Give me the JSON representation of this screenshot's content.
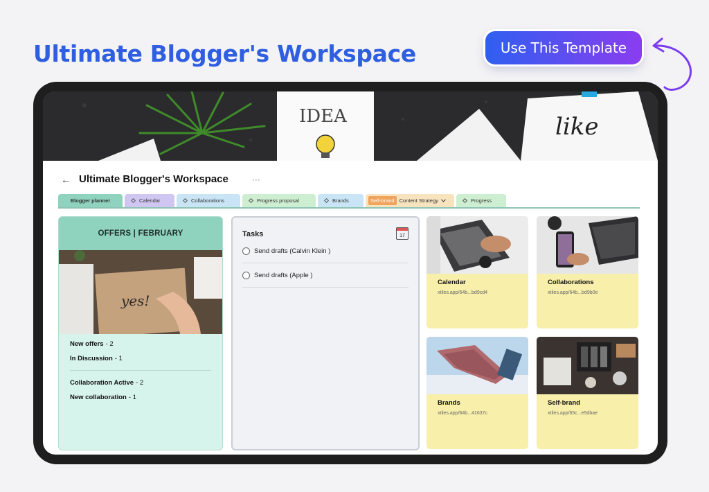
{
  "promo": {
    "title": "Ultimate Blogger's Workspace",
    "cta_label": "Use This Template"
  },
  "banner": {
    "card_word_1": "IDEA",
    "card_word_2": "like"
  },
  "doc": {
    "title": "Ultimate Blogger's Workspace",
    "more": "···",
    "back": "←"
  },
  "tabs": [
    {
      "label": "Blogger planner"
    },
    {
      "label": "Calendar"
    },
    {
      "label": "Collaborations"
    },
    {
      "label": "Progress proposal"
    },
    {
      "label": "Brands"
    },
    {
      "badge": "Self-brand",
      "label": "Content Strategy"
    },
    {
      "label": "Progress"
    }
  ],
  "offers": {
    "title": "OFFERS | FEBRUARY",
    "image_text": "yes!",
    "rows": [
      {
        "label": "New offers",
        "value": "- 2"
      },
      {
        "label": "In Discussion",
        "value": "- 1"
      },
      {
        "label": "Collaboration Active",
        "value": " - 2"
      },
      {
        "label": "New collaboration",
        "value": "- 1"
      }
    ]
  },
  "tasks": {
    "title": "Tasks",
    "calendar_day": "17",
    "items": [
      {
        "label": "Send drafts (Calvin Klein )"
      },
      {
        "label": "Send drafts (Apple )"
      }
    ]
  },
  "tiles": [
    {
      "name": "Calendar",
      "link": "xtiles.app/64b...bd9cd4"
    },
    {
      "name": "Collaborations",
      "link": "xtiles.app/64b...bd9b0e"
    },
    {
      "name": "Brands",
      "link": "xtiles.app/64b...41637c"
    },
    {
      "name": "Self-brand",
      "link": "xtiles.app/65c...e5dbae"
    }
  ],
  "colors": {
    "brand_blue": "#2f5fe0",
    "cta_gradient_start": "#2f5ff0",
    "cta_gradient_end": "#8a3df0",
    "offers_header": "#8fd3bf",
    "tile_bg": "#f7efaa"
  }
}
